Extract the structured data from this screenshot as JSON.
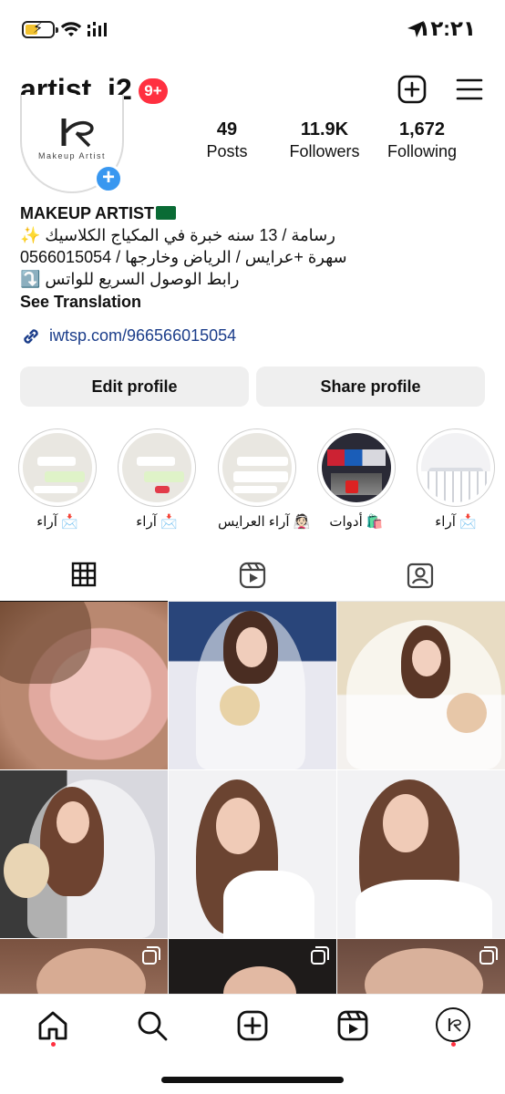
{
  "status_bar": {
    "time": "١٢:٢١",
    "battery_level": 0.4,
    "icons": [
      "battery-charging-icon",
      "wifi-icon",
      "signal-icon",
      "location-arrow-icon"
    ]
  },
  "header": {
    "username": "artist_i2",
    "notification_badge": "9+",
    "icons": [
      "new-post-icon",
      "menu-icon"
    ]
  },
  "profile": {
    "avatar_text": "Makeup Artist",
    "stats": [
      {
        "value": "49",
        "label": "Posts"
      },
      {
        "value": "11.9K",
        "label": "Followers"
      },
      {
        "value": "1,672",
        "label": "Following"
      }
    ],
    "bio": {
      "name": "MAKEUP ARTIST",
      "line1": "رسامة / 13 سنه خبرة في المكياج الكلاسيك ✨",
      "line2": "سهرة +عرايس / الرياض وخارجها / 0566015054",
      "line3": "رابط الوصول السريع للواتس ⤵️",
      "see_translation": "See Translation"
    },
    "link": "iwtsp.com/966566015054"
  },
  "buttons": {
    "edit": "Edit profile",
    "share": "Share profile"
  },
  "highlights": [
    {
      "label": "آراء 📩",
      "style": "chat"
    },
    {
      "label": "آراء 📩",
      "style": "chat"
    },
    {
      "label": "آراء العرايس 👰🏻",
      "style": "chat"
    },
    {
      "label": "أدوات 🛍️",
      "style": "studio"
    },
    {
      "label": "آراء 📩",
      "style": "keyboard"
    }
  ],
  "tabs": [
    {
      "name": "posts-grid-tab",
      "icon": "grid-icon",
      "active": true
    },
    {
      "name": "reels-tab",
      "icon": "reels-icon",
      "active": false
    },
    {
      "name": "tagged-tab",
      "icon": "tagged-icon",
      "active": false
    }
  ],
  "bottom_nav": [
    "home-icon",
    "search-icon",
    "create-icon",
    "reels-icon",
    "profile-avatar"
  ]
}
